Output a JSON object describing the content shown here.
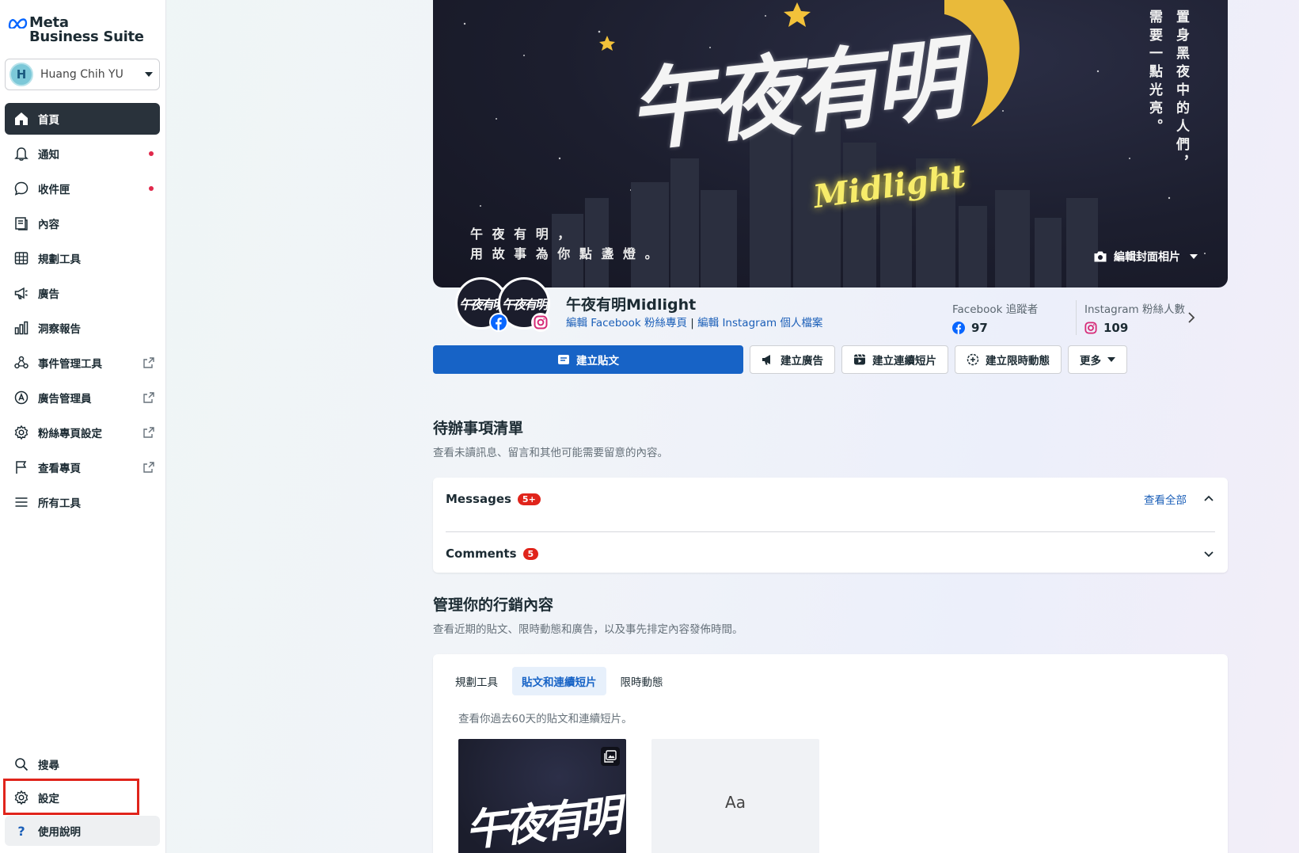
{
  "brand": {
    "line1": "Meta",
    "line2": "Business Suite"
  },
  "account": {
    "initial": "H",
    "name": "Huang Chih YU"
  },
  "nav": {
    "items": [
      {
        "label": "首頁"
      },
      {
        "label": "通知"
      },
      {
        "label": "收件匣"
      },
      {
        "label": "內容"
      },
      {
        "label": "規劃工具"
      },
      {
        "label": "廣告"
      },
      {
        "label": "洞察報告"
      },
      {
        "label": "事件管理工具"
      },
      {
        "label": "廣告管理員"
      },
      {
        "label": "粉絲專頁設定"
      },
      {
        "label": "查看專頁"
      },
      {
        "label": "所有工具"
      }
    ],
    "bottom": [
      {
        "label": "搜尋"
      },
      {
        "label": "設定"
      },
      {
        "label": "使用說明"
      }
    ]
  },
  "cover": {
    "title": "午夜有明",
    "brand_script": "Midlight",
    "slogan_line1": "午 夜 有 明 ，",
    "slogan_line2": "用 故 事 為 你 點 盞 燈 。",
    "vertical_text": "置身黑夜中的人們，需要一點光亮。",
    "edit_label": "編輯封面相片"
  },
  "page": {
    "avatar_text": "午夜有明",
    "name": "午夜有明Midlight",
    "edit_fb": "編輯 Facebook 粉絲專頁",
    "separator": " | ",
    "edit_ig": "編輯 Instagram 個人檔案"
  },
  "stats": {
    "fb_label": "Facebook 追蹤者",
    "fb_value": "97",
    "ig_label": "Instagram 粉絲人數",
    "ig_value": "109"
  },
  "actions": {
    "create_post": "建立貼文",
    "create_ad": "建立廣告",
    "create_reel": "建立連續短片",
    "create_story": "建立限時動態",
    "more": "更多"
  },
  "todo": {
    "title": "待辦事項清單",
    "subtitle": "查看未讀訊息、留言和其他可能需要留意的內容。",
    "messages_label": "Messages",
    "messages_count": "5+",
    "view_all": "查看全部",
    "comments_label": "Comments",
    "comments_count": "5"
  },
  "marketing": {
    "title": "管理你的行銷內容",
    "subtitle": "查看近期的貼文、限時動態和廣告，以及事先排定內容發佈時間。",
    "tabs": [
      {
        "label": "規劃工具"
      },
      {
        "label": "貼文和連續短片"
      },
      {
        "label": "限時動態"
      }
    ],
    "note": "查看你過去60天的貼文和連續短片。",
    "thumb_title": "午夜有明",
    "thumb_text_placeholder": "Aa"
  },
  "colors": {
    "primary": "#1763c6",
    "alert": "#e0241b",
    "sidebar_active": "#29323b",
    "link": "#1b5fb8"
  }
}
